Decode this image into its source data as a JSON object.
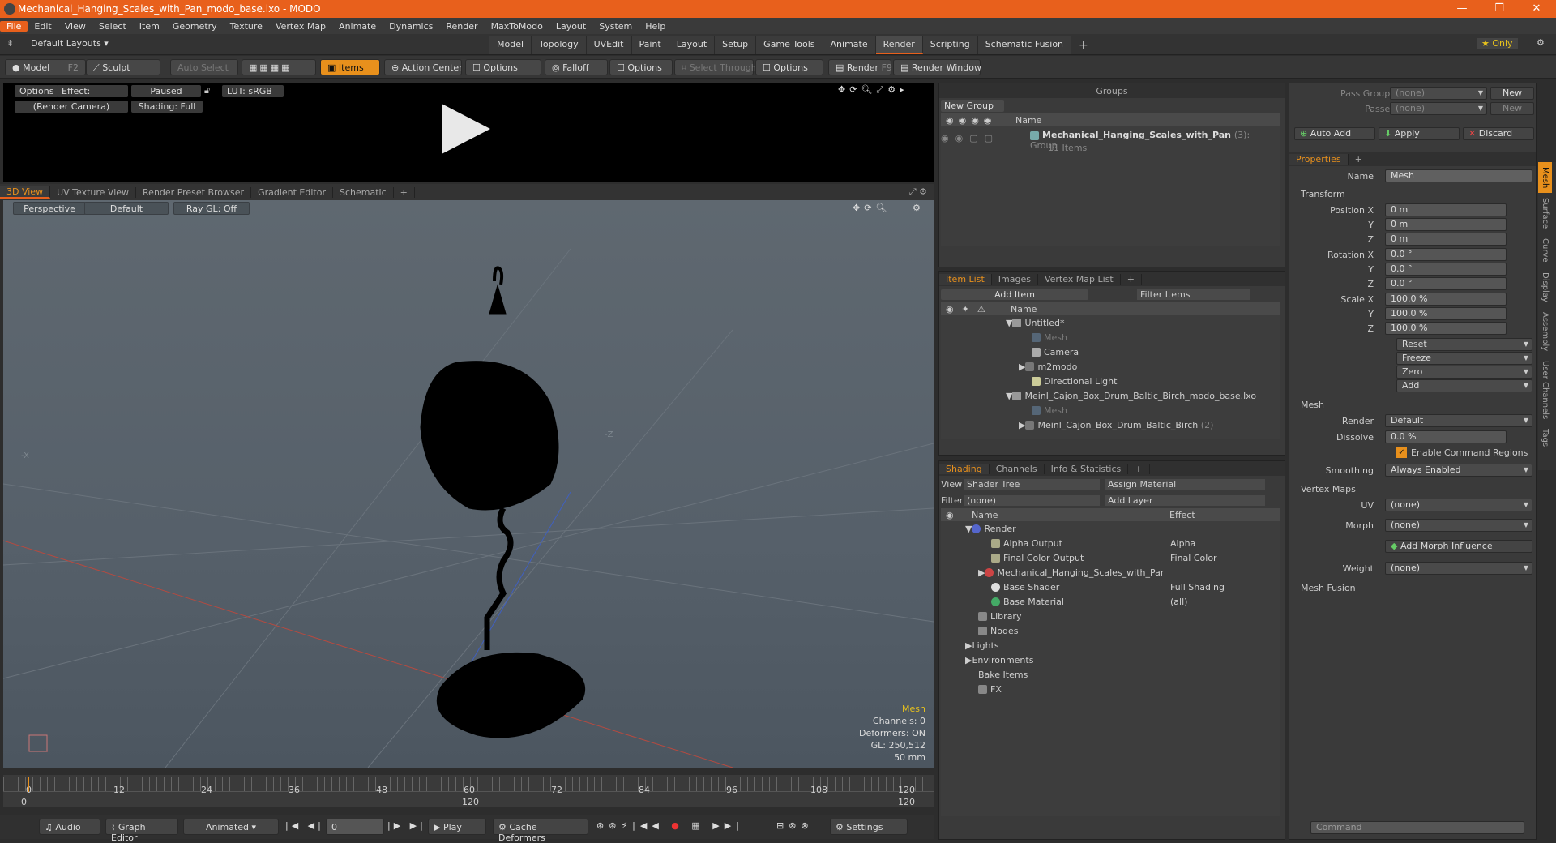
{
  "window": {
    "title": "Mechanical_Hanging_Scales_with_Pan_modo_base.lxo - MODO",
    "minimize": "—",
    "maximize": "❐",
    "close": "✕"
  },
  "menu": [
    "File",
    "Edit",
    "View",
    "Select",
    "Item",
    "Geometry",
    "Texture",
    "Vertex Map",
    "Animate",
    "Dynamics",
    "Render",
    "MaxToModo",
    "Layout",
    "System",
    "Help"
  ],
  "layoutbar": {
    "layouts": "Default Layouts ▾",
    "tabs": [
      "Model",
      "Topology",
      "UVEdit",
      "Paint",
      "Layout",
      "Setup",
      "Game Tools",
      "Animate",
      "Render",
      "Scripting",
      "Schematic Fusion"
    ],
    "add": "+",
    "only": "★  Only"
  },
  "toolbar": {
    "model": "Model",
    "model_key": "F2",
    "sculpt": "Sculpt",
    "auto_select": "Auto Select",
    "items": "Items",
    "action_center": "Action Center",
    "options1": "Options",
    "falloff": "Falloff",
    "options2": "Options",
    "select_through": "Select Through",
    "options3": "Options",
    "render": "Render",
    "render_key": "F9",
    "render_window": "Render Window"
  },
  "renderview": {
    "options": "Options",
    "effect": "Effect: (Shadi...",
    "paused": "Paused",
    "lut": "LUT: sRGB",
    "camera": "(Render Camera)",
    "shading": "Shading: Full"
  },
  "vptabs": [
    "3D View",
    "UV Texture View",
    "Render Preset Browser",
    "Gradient Editor",
    "Schematic",
    "+"
  ],
  "viewport": {
    "perspective": "Perspective",
    "default": "Default",
    "raygl": "Ray GL: Off",
    "stats": {
      "type": "Mesh",
      "channels": "Channels: 0",
      "deformers": "Deformers: ON",
      "gl": "GL: 250,512",
      "focal": "50 mm"
    }
  },
  "timeline": {
    "ticks": [
      "0",
      "12",
      "24",
      "36",
      "48",
      "60",
      "72",
      "84",
      "96",
      "108",
      "120"
    ],
    "start": "0",
    "mid": "120",
    "end": "120"
  },
  "bottombar": {
    "audio": "Audio",
    "graph_editor": "Graph Editor",
    "animated": "Animated",
    "frame": "0",
    "play": "Play",
    "cache": "Cache Deformers",
    "settings": "Settings"
  },
  "groups": {
    "title": "Groups",
    "new_group": "New Group",
    "col_name": "Name",
    "item_name": "Mechanical_Hanging_Scales_with_Pan",
    "item_count": "(3)",
    "item_type": ": Group",
    "item_sub": "11 Items"
  },
  "itemlist": {
    "tabs": [
      "Item List",
      "Images",
      "Vertex Map List",
      "+"
    ],
    "add_item": "Add Item",
    "filter": "Filter Items",
    "col_name": "Name",
    "rows": [
      "Untitled*",
      "Mesh",
      "Camera",
      "m2modo",
      "Directional Light",
      "Meinl_Cajon_Box_Drum_Baltic_Birch_modo_base.lxo",
      "Mesh",
      "Meinl_Cajon_Box_Drum_Baltic_Birch"
    ],
    "row_extra": "(2)"
  },
  "shading": {
    "tabs": [
      "Shading",
      "Channels",
      "Info & Statistics",
      "+"
    ],
    "view_label": "View",
    "view": "Shader Tree",
    "assign": "Assign Material",
    "filter_label": "Filter",
    "filter": "(none)",
    "add_layer": "Add Layer",
    "col_name": "Name",
    "col_effect": "Effect",
    "rows": [
      {
        "name": "Render",
        "effect": ""
      },
      {
        "name": "Alpha Output",
        "effect": "Alpha"
      },
      {
        "name": "Final Color Output",
        "effect": "Final Color"
      },
      {
        "name": "Mechanical_Hanging_Scales_with_Pan",
        "effect": ""
      },
      {
        "name": "Base Shader",
        "effect": "Full Shading"
      },
      {
        "name": "Base Material",
        "effect": "(all)"
      },
      {
        "name": "Library",
        "effect": ""
      },
      {
        "name": "Nodes",
        "effect": ""
      },
      {
        "name": "Lights",
        "effect": ""
      },
      {
        "name": "Environments",
        "effect": ""
      },
      {
        "name": "Bake Items",
        "effect": ""
      },
      {
        "name": "FX",
        "effect": ""
      }
    ]
  },
  "passes": {
    "pass_groups": "Pass Groups",
    "pass_groups_val": "(none)",
    "new": "New",
    "passes": "Passes",
    "passes_val": "(none)",
    "new2": "New",
    "auto_add": "Auto Add",
    "apply": "Apply",
    "discard": "Discard"
  },
  "properties": {
    "tab": "Properties",
    "add": "+",
    "name_label": "Name",
    "name": "Mesh",
    "transform": "Transform",
    "pos_x": "Position X",
    "y": "Y",
    "z": "Z",
    "pos_vals": [
      "0 m",
      "0 m",
      "0 m"
    ],
    "rot_x": "Rotation X",
    "rot_vals": [
      "0.0 °",
      "0.0 °",
      "0.0 °"
    ],
    "scale_x": "Scale X",
    "scale_vals": [
      "100.0 %",
      "100.0 %",
      "100.0 %"
    ],
    "actions": [
      "Reset",
      "Freeze",
      "Zero",
      "Add"
    ],
    "mesh": "Mesh",
    "render_label": "Render",
    "render": "Default",
    "dissolve_label": "Dissolve",
    "dissolve": "0.0 %",
    "cmd_regions": "Enable Command Regions",
    "smoothing_label": "Smoothing",
    "smoothing": "Always Enabled",
    "vertex_maps": "Vertex Maps",
    "uv_label": "UV",
    "uv": "(none)",
    "morph_label": "Morph",
    "morph": "(none)",
    "add_morph": "Add Morph Influence",
    "weight_label": "Weight",
    "weight": "(none)",
    "mesh_fusion": "Mesh Fusion"
  },
  "sidetabs": [
    "Mesh",
    "Surface",
    "Curve",
    "Display",
    "Assembly",
    "User Channels",
    "Tags"
  ],
  "command": {
    "placeholder": "Command"
  }
}
